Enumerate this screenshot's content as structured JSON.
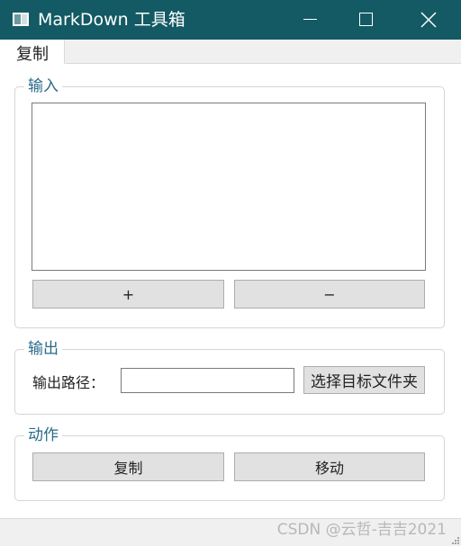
{
  "window": {
    "title": "MarkDown 工具箱",
    "titlebar_color": "#135a64"
  },
  "tabs": [
    {
      "label": "复制",
      "active": true
    }
  ],
  "input_group": {
    "title": "输入",
    "textarea_value": "",
    "add_label": "+",
    "remove_label": "−"
  },
  "output_group": {
    "title": "输出",
    "path_label": "输出路径：",
    "path_value": "",
    "select_folder_label": "选择目标文件夹"
  },
  "action_group": {
    "title": "动作",
    "copy_label": "复制",
    "move_label": "移动"
  },
  "watermark": "CSDN @云哲-吉吉2021"
}
